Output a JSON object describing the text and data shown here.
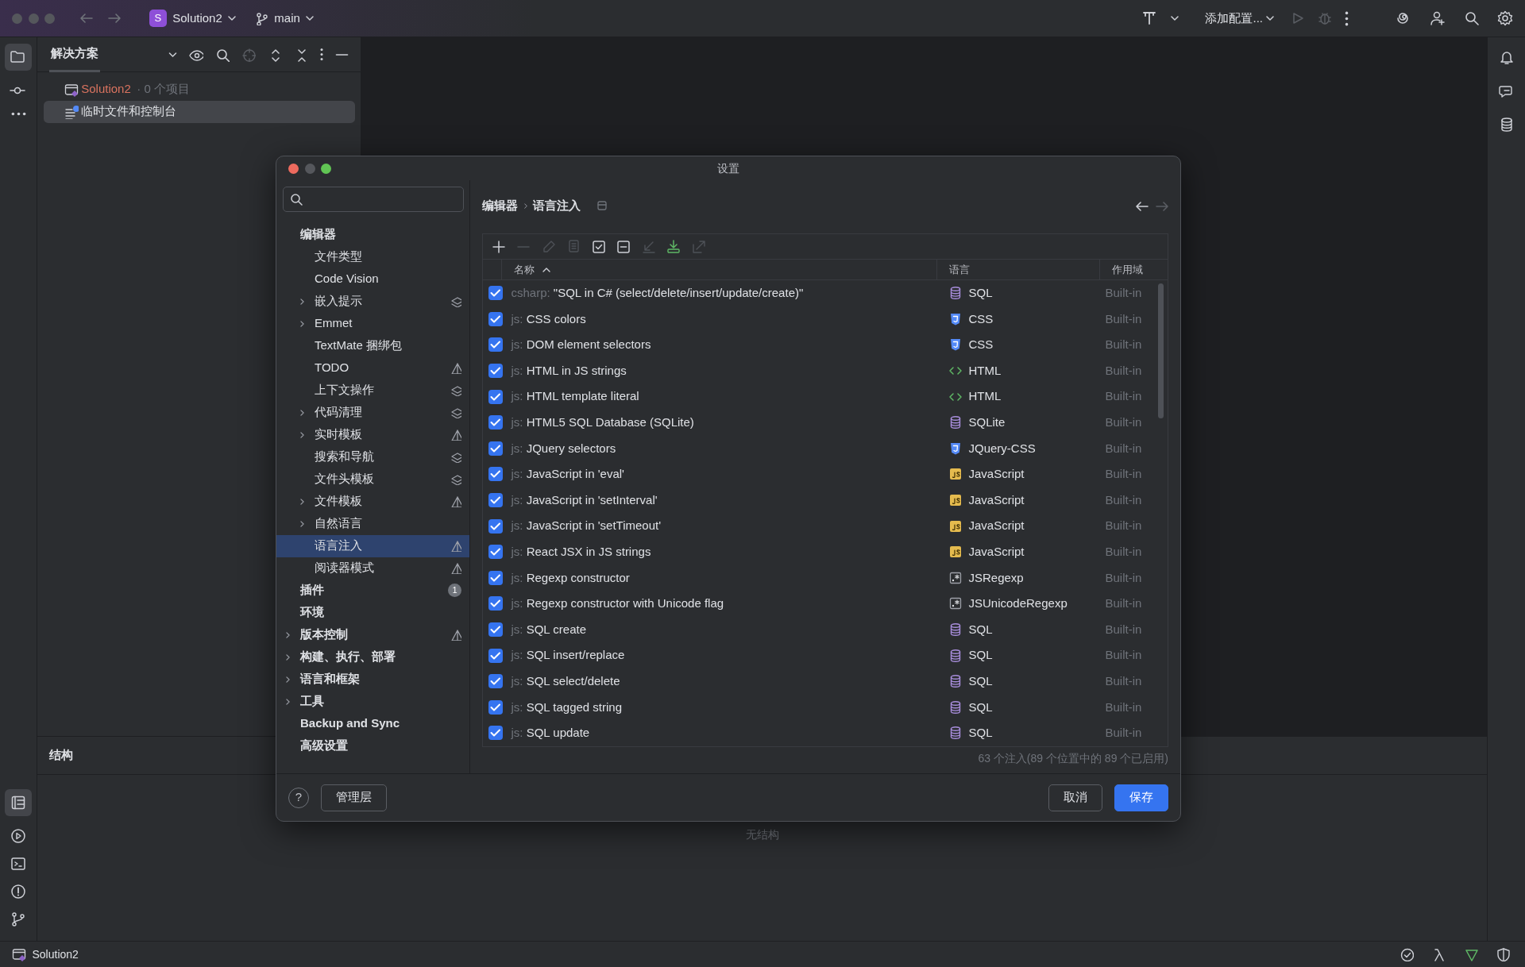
{
  "toolbar": {
    "project_initial": "S",
    "project": "Solution2",
    "branch": "main",
    "run_config": "添加配置..."
  },
  "project_panel": {
    "title": "解决方案",
    "tree": [
      {
        "label": "Solution2",
        "suffix": "· 0 个项目",
        "selected": false
      },
      {
        "label": "临时文件和控制台",
        "selected": true
      }
    ]
  },
  "structure_panel": {
    "title": "结构",
    "empty_text": "无结构"
  },
  "status_bar": {
    "project": "Solution2"
  },
  "dialog": {
    "title": "设置",
    "nav": [
      {
        "label": "编辑器",
        "selected": false,
        "collapsed": false,
        "kind": "plain",
        "children": [
          {
            "label": "文件类型",
            "selected": false,
            "collapsed": false,
            "kind": "plain"
          },
          {
            "label": "Code Vision",
            "selected": false,
            "collapsed": false,
            "kind": "plain"
          },
          {
            "label": "嵌入提示",
            "selected": false,
            "collapsed": true,
            "kind": "layers"
          },
          {
            "label": "Emmet",
            "selected": false,
            "collapsed": true,
            "kind": "plain"
          },
          {
            "label": "TextMate 捆绑包",
            "selected": false,
            "collapsed": false,
            "kind": "plain"
          },
          {
            "label": "TODO",
            "selected": false,
            "collapsed": false,
            "kind": "pyramid"
          },
          {
            "label": "上下文操作",
            "selected": false,
            "collapsed": false,
            "kind": "layers"
          },
          {
            "label": "代码清理",
            "selected": false,
            "collapsed": true,
            "kind": "layers"
          },
          {
            "label": "实时模板",
            "selected": false,
            "collapsed": true,
            "kind": "pyramid"
          },
          {
            "label": "搜索和导航",
            "selected": false,
            "collapsed": false,
            "kind": "layers"
          },
          {
            "label": "文件头模板",
            "selected": false,
            "collapsed": false,
            "kind": "layers"
          },
          {
            "label": "文件模板",
            "selected": false,
            "collapsed": true,
            "kind": "pyramid"
          },
          {
            "label": "自然语言",
            "selected": false,
            "collapsed": true,
            "kind": "plain"
          },
          {
            "label": "语言注入",
            "selected": true,
            "collapsed": false,
            "kind": "pyramid"
          },
          {
            "label": "阅读器模式",
            "selected": false,
            "collapsed": false,
            "kind": "pyramid"
          }
        ]
      },
      {
        "label": "插件",
        "selected": false,
        "collapsed": false,
        "kind": "plain",
        "count": "1"
      },
      {
        "label": "环境",
        "selected": false,
        "collapsed": false,
        "kind": "plain"
      },
      {
        "label": "版本控制",
        "selected": false,
        "collapsed": true,
        "kind": "pyramid"
      },
      {
        "label": "构建、执行、部署",
        "selected": false,
        "collapsed": true,
        "kind": "plain"
      },
      {
        "label": "语言和框架",
        "selected": false,
        "collapsed": true,
        "kind": "plain"
      },
      {
        "label": "工具",
        "selected": false,
        "collapsed": true,
        "kind": "plain"
      },
      {
        "label": "Backup and Sync",
        "selected": false,
        "collapsed": false,
        "kind": "plain"
      },
      {
        "label": "高级设置",
        "selected": false,
        "collapsed": false,
        "kind": "plain"
      }
    ],
    "breadcrumb": [
      "编辑器",
      "语言注入"
    ],
    "table_toolbar": [
      {
        "kind": "add",
        "disabled": false
      },
      {
        "kind": "remove",
        "disabled": true
      },
      {
        "kind": "edit",
        "disabled": true
      },
      {
        "kind": "copy",
        "disabled": true
      },
      {
        "kind": "enable-all",
        "disabled": false
      },
      {
        "kind": "disable-all",
        "disabled": false
      },
      {
        "kind": "import",
        "disabled": true
      },
      {
        "kind": "download",
        "disabled": false
      },
      {
        "kind": "export",
        "disabled": true
      }
    ],
    "table": {
      "columns": [
        "名称",
        "语言",
        "作用域"
      ],
      "rows": [
        {
          "checked": true,
          "prefix": "csharp:",
          "name": "\"SQL in C# (select/delete/insert/update/create)\"",
          "language": "SQL",
          "kind": "sql",
          "scope": "Built-in"
        },
        {
          "checked": true,
          "prefix": "js:",
          "name": "CSS colors",
          "language": "CSS",
          "kind": "css",
          "scope": "Built-in"
        },
        {
          "checked": true,
          "prefix": "js:",
          "name": "DOM element selectors",
          "language": "CSS",
          "kind": "css",
          "scope": "Built-in"
        },
        {
          "checked": true,
          "prefix": "js:",
          "name": "HTML in JS strings",
          "language": "HTML",
          "kind": "html",
          "scope": "Built-in"
        },
        {
          "checked": true,
          "prefix": "js:",
          "name": "HTML template literal",
          "language": "HTML",
          "kind": "html",
          "scope": "Built-in"
        },
        {
          "checked": true,
          "prefix": "js:",
          "name": "HTML5 SQL Database (SQLite)",
          "language": "SQLite",
          "kind": "sql",
          "scope": "Built-in"
        },
        {
          "checked": true,
          "prefix": "js:",
          "name": "JQuery selectors",
          "language": "JQuery-CSS",
          "kind": "css",
          "scope": "Built-in"
        },
        {
          "checked": true,
          "prefix": "js:",
          "name": "JavaScript in 'eval'",
          "language": "JavaScript",
          "kind": "js",
          "scope": "Built-in"
        },
        {
          "checked": true,
          "prefix": "js:",
          "name": "JavaScript in 'setInterval'",
          "language": "JavaScript",
          "kind": "js",
          "scope": "Built-in"
        },
        {
          "checked": true,
          "prefix": "js:",
          "name": "JavaScript in 'setTimeout'",
          "language": "JavaScript",
          "kind": "js",
          "scope": "Built-in"
        },
        {
          "checked": true,
          "prefix": "js:",
          "name": "React JSX in JS strings",
          "language": "JavaScript",
          "kind": "js",
          "scope": "Built-in"
        },
        {
          "checked": true,
          "prefix": "js:",
          "name": "Regexp constructor",
          "language": "JSRegexp",
          "kind": "regexp",
          "scope": "Built-in"
        },
        {
          "checked": true,
          "prefix": "js:",
          "name": "Regexp constructor with Unicode flag",
          "language": "JSUnicodeRegexp",
          "kind": "regexp",
          "scope": "Built-in"
        },
        {
          "checked": true,
          "prefix": "js:",
          "name": "SQL create",
          "language": "SQL",
          "kind": "sql",
          "scope": "Built-in"
        },
        {
          "checked": true,
          "prefix": "js:",
          "name": "SQL insert/replace",
          "language": "SQL",
          "kind": "sql",
          "scope": "Built-in"
        },
        {
          "checked": true,
          "prefix": "js:",
          "name": "SQL select/delete",
          "language": "SQL",
          "kind": "sql",
          "scope": "Built-in"
        },
        {
          "checked": true,
          "prefix": "js:",
          "name": "SQL tagged string",
          "language": "SQL",
          "kind": "sql",
          "scope": "Built-in"
        },
        {
          "checked": true,
          "prefix": "js:",
          "name": "SQL update",
          "language": "SQL",
          "kind": "sql",
          "scope": "Built-in"
        }
      ]
    },
    "summary": "63 个注入(89 个位置中的 89 个已启用)",
    "help": "?",
    "buttons": [
      {
        "label": "管理层",
        "kind": "secondary"
      },
      {
        "label": "取消",
        "kind": "secondary"
      },
      {
        "label": "保存",
        "kind": "primary"
      }
    ]
  }
}
